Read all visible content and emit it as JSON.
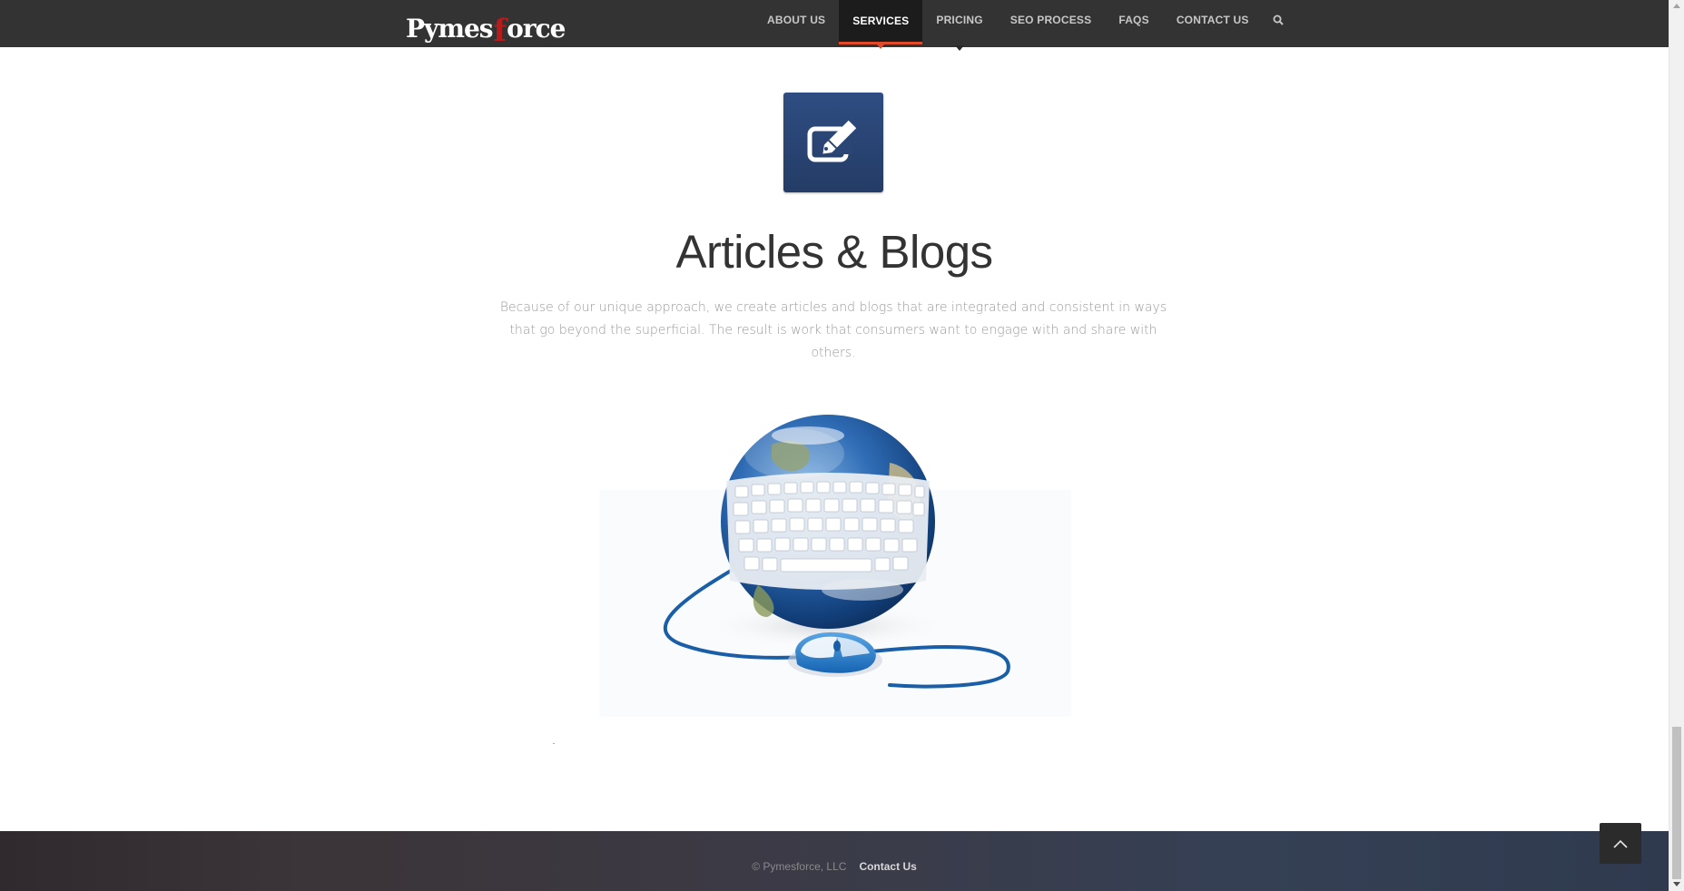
{
  "header": {
    "logo": {
      "left": "Pymes",
      "mark": "f",
      "right": "orce"
    },
    "nav": [
      {
        "label": "ABOUT US"
      },
      {
        "label": "SERVICES",
        "active": true
      },
      {
        "label": "PRICING"
      },
      {
        "label": "SEO PROCESS"
      },
      {
        "label": "FAQS"
      },
      {
        "label": "CONTACT US"
      }
    ],
    "search_icon": "search-icon"
  },
  "main": {
    "feature_icon": "edit-pencil-icon",
    "title": "Articles & Blogs",
    "description": "Because of our unique approach, we create articles and blogs that are integrated and consistent in ways that go beyond the superficial. The result is work that consumers want to engage with and share with others.",
    "illustration": "globe-keyboard-mouse-image"
  },
  "footer": {
    "copyright": "© Pymesforce, LLC",
    "link": "Contact Us"
  },
  "colors": {
    "header_bg": "#333333",
    "accent": "#e0492a",
    "icon_box": "#2f4d82",
    "footer_bg": "#3a3a44"
  }
}
